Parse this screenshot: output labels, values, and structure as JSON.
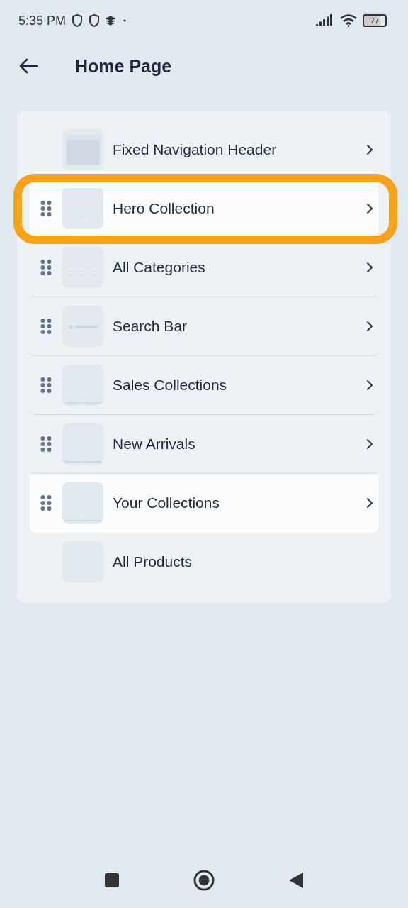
{
  "status_bar": {
    "time": "5:35 PM",
    "battery": "77"
  },
  "header": {
    "title": "Home Page"
  },
  "sections": [
    {
      "label": "Fixed Navigation Header",
      "kind": "header",
      "draggable": false,
      "chevron": true,
      "highlighted": false,
      "selected": false,
      "divider": false
    },
    {
      "label": "Hero Collection",
      "kind": "hero",
      "draggable": true,
      "chevron": true,
      "highlighted": true,
      "selected": true,
      "divider": false
    },
    {
      "label": "All Categories",
      "kind": "categories",
      "draggable": true,
      "chevron": true,
      "highlighted": false,
      "selected": false,
      "divider": true
    },
    {
      "label": "Search Bar",
      "kind": "search",
      "draggable": true,
      "chevron": true,
      "highlighted": false,
      "selected": false,
      "divider": true
    },
    {
      "label": "Sales Collections",
      "kind": "grid3",
      "draggable": true,
      "chevron": true,
      "highlighted": false,
      "selected": false,
      "divider": true
    },
    {
      "label": "New Arrivals",
      "kind": "grid3",
      "draggable": true,
      "chevron": true,
      "highlighted": false,
      "selected": false,
      "divider": true
    },
    {
      "label": "Your Collections",
      "kind": "grid3",
      "draggable": true,
      "chevron": true,
      "highlighted": false,
      "selected": true,
      "divider": false
    },
    {
      "label": "All Products",
      "kind": "grid4",
      "draggable": false,
      "chevron": false,
      "highlighted": false,
      "selected": false,
      "divider": false
    }
  ]
}
